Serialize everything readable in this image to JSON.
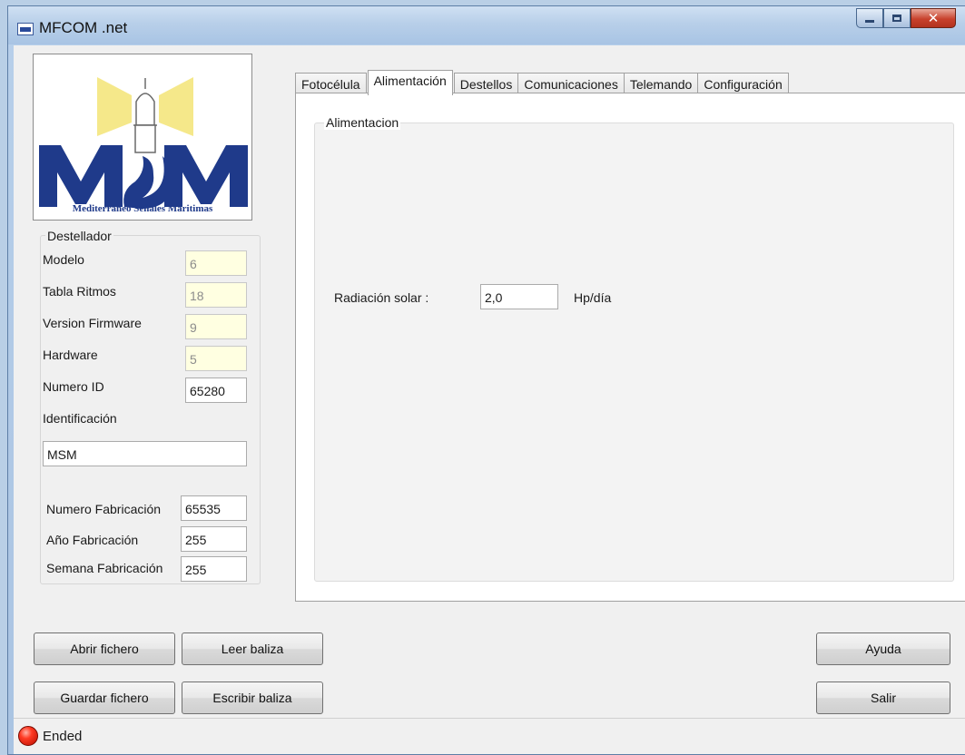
{
  "window": {
    "title": "MFCOM .net"
  },
  "logo": {
    "caption": "Mediterráneo Señales Maritimas"
  },
  "destellador": {
    "legend": "Destellador",
    "modelo_label": "Modelo",
    "modelo_value": "6",
    "tabla_ritmos_label": "Tabla Ritmos",
    "tabla_ritmos_value": "18",
    "version_firmware_label": "Version Firmware",
    "version_firmware_value": "9",
    "hardware_label": "Hardware",
    "hardware_value": "5",
    "numero_id_label": "Numero ID",
    "numero_id_value": "65280",
    "identificacion_label": "Identificación",
    "identificacion_value": "MSM",
    "numero_fabricacion_label": "Numero Fabricación",
    "numero_fabricacion_value": "65535",
    "anio_fabricacion_label": "Año Fabricación",
    "anio_fabricacion_value": "255",
    "semana_fabricacion_label": "Semana Fabricación",
    "semana_fabricacion_value": "255"
  },
  "tabs": [
    {
      "label": "Fotocélula",
      "active": false
    },
    {
      "label": "Alimentación",
      "active": true
    },
    {
      "label": "Destellos",
      "active": false
    },
    {
      "label": "Comunicaciones",
      "active": false
    },
    {
      "label": "Telemando",
      "active": false
    },
    {
      "label": "Configuración",
      "active": false
    }
  ],
  "alimentacion": {
    "legend": "Alimentacion",
    "radiacion_label": "Radiación solar :",
    "radiacion_value": "2,0",
    "radiacion_unit": "Hp/día"
  },
  "buttons": {
    "abrir_fichero": "Abrir fichero",
    "leer_baliza": "Leer baliza",
    "guardar_fichero": "Guardar fichero",
    "escribir_baliza": "Escribir baliza",
    "ayuda": "Ayuda",
    "salir": "Salir"
  },
  "status": {
    "text": "Ended",
    "led_color": "#e02010"
  },
  "colors": {
    "logo_blue": "#1f3a8a",
    "logo_yellow": "#f5e88a",
    "readonly_bg": "#ffffe1"
  }
}
